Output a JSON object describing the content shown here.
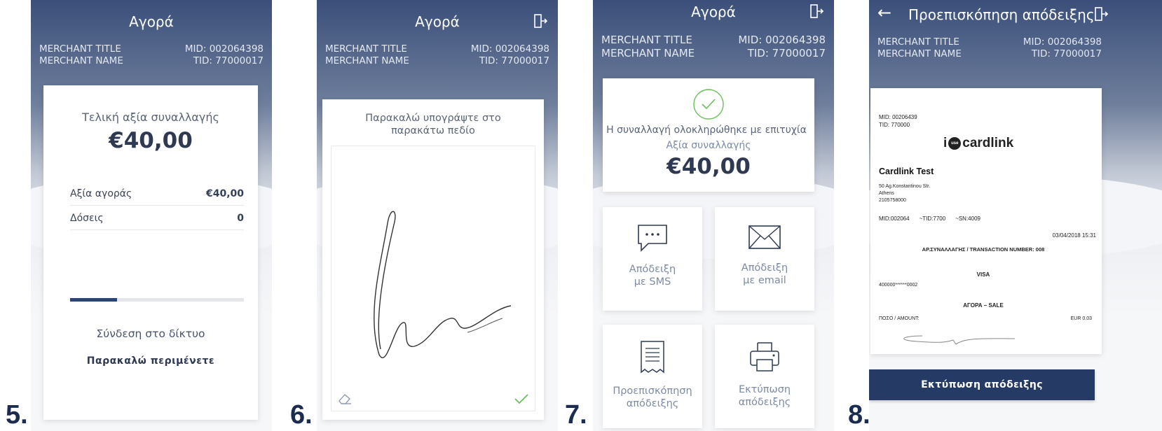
{
  "steps": [
    "5.",
    "6.",
    "7.",
    "8."
  ],
  "merchant": {
    "title": "MERCHANT TITLE",
    "name": "MERCHANT NAME",
    "mid": "MID: 002064398",
    "tid": "TID: 77000017"
  },
  "screen5": {
    "header": "Αγορά",
    "final_label": "Τελική αξία συναλλαγής",
    "final_amount": "€40,00",
    "rows": [
      {
        "label": "Αξία αγοράς",
        "value": "€40,00"
      },
      {
        "label": "Δόσεις",
        "value": "0"
      }
    ],
    "progress": 0.27,
    "status": "Σύνδεση στο δίκτυο",
    "wait": "Παρακαλώ περιμένετε"
  },
  "screen6": {
    "header": "Αγορά",
    "instruction_line1": "Παρακαλώ υπογράψτε στο",
    "instruction_line2": "παρακάτω πεδίο"
  },
  "screen7": {
    "header": "Αγορά",
    "success": "Η συναλλαγή ολοκληρώθηκε με επιτυχία",
    "amount_label": "Αξία συναλλαγής",
    "amount": "€40,00",
    "tiles": [
      {
        "l1": "Απόδειξη",
        "l2": "με SMS",
        "icon": "sms-icon"
      },
      {
        "l1": "Απόδειξη",
        "l2": "με email",
        "icon": "email-icon"
      },
      {
        "l1": "Προεπισκόπηση",
        "l2": "απόδειξης",
        "icon": "receipt-icon"
      },
      {
        "l1": "Εκτύπωση",
        "l2": "απόδειξης",
        "icon": "printer-icon"
      }
    ]
  },
  "screen8": {
    "header": "Προεπισκόπηση απόδειξης",
    "mid_short": "MID: 00206439",
    "tid_short": "TID: 770000",
    "logo_prefix": "i",
    "logo_badge": "use",
    "logo_text": "cardlink",
    "company": "Cardlink Test",
    "addr1": "50 Ag.Konstantinou Str.",
    "addr2": "Athens",
    "phone": "2105758000",
    "ids_mid": "MID:002064",
    "ids_tid": "~TID:7700",
    "ids_sn": "~SN:4009",
    "datetime": "03/04/2018 15:31",
    "txn_number": "ΑΡ.ΣΥΝΑΛΛΑΓΗΣ / TRANSACTION NUMBER: 008",
    "card_brand": "VISA",
    "card_number": "400000******0002",
    "sale": "ΑΓΟΡΑ – SALE",
    "amount_label": "ΠΟΣΟ / AMOUNT:",
    "amount_value": "EUR 0.03",
    "print_button": "Εκτύπωση απόδειξης"
  }
}
